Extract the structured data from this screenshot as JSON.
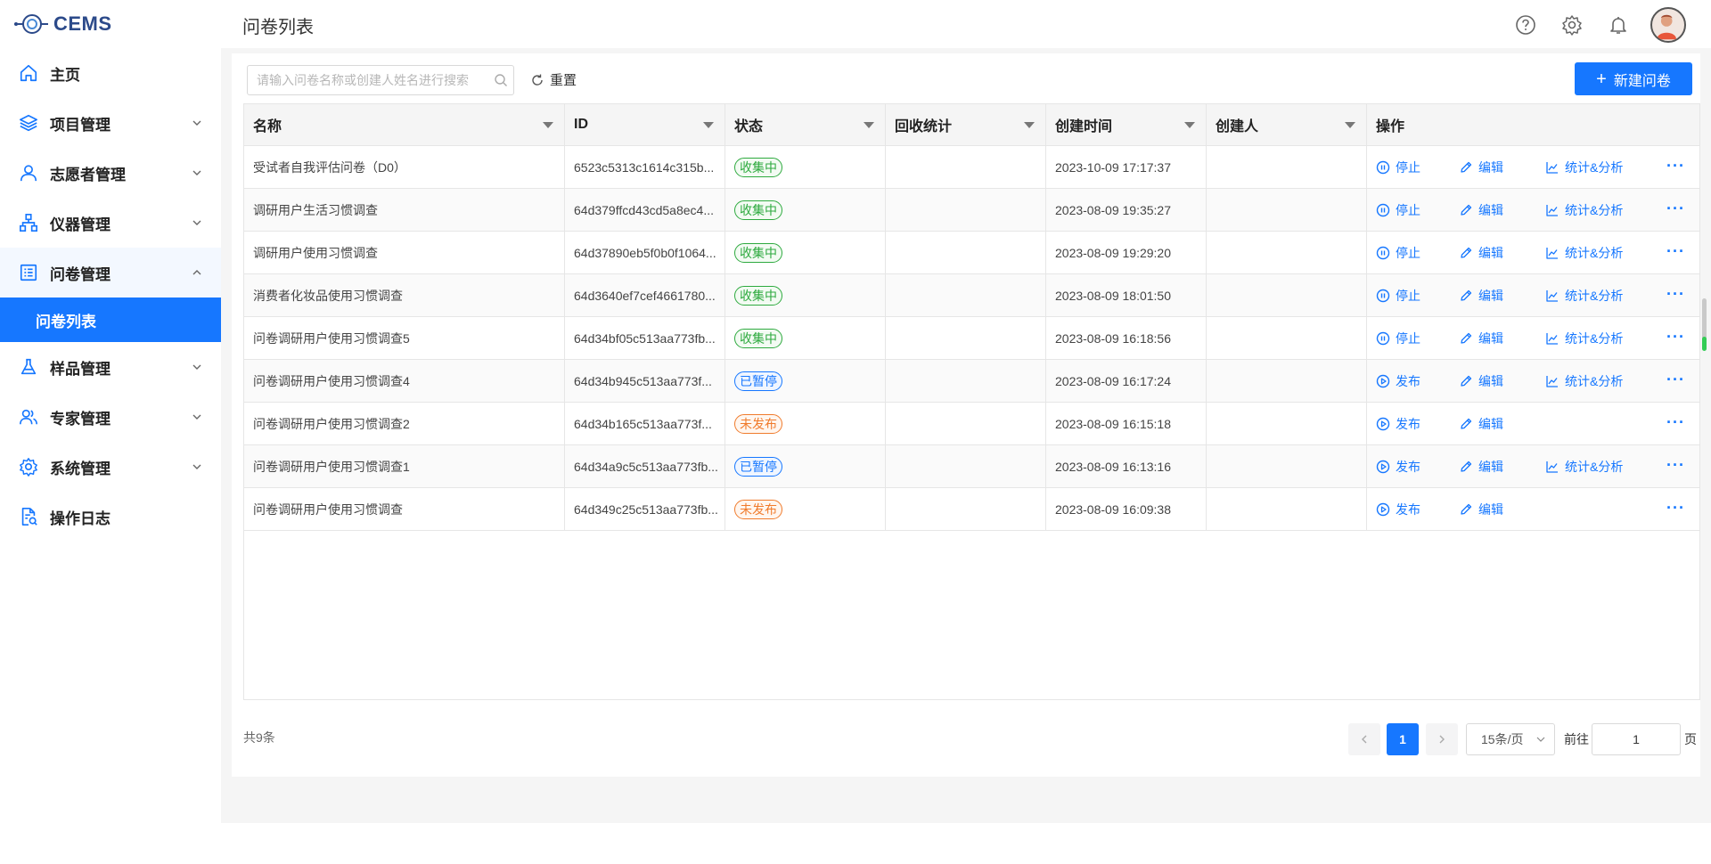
{
  "app": {
    "logo_text": "CEMS"
  },
  "header": {
    "title": "问卷列表"
  },
  "sidebar": {
    "items": [
      {
        "label": "主页",
        "icon": "home-icon"
      },
      {
        "label": "项目管理",
        "icon": "layers-icon"
      },
      {
        "label": "志愿者管理",
        "icon": "user-icon"
      },
      {
        "label": "仪器管理",
        "icon": "network-icon"
      },
      {
        "label": "问卷管理",
        "icon": "form-icon"
      },
      {
        "label": "样品管理",
        "icon": "flask-icon"
      },
      {
        "label": "专家管理",
        "icon": "users-icon"
      },
      {
        "label": "系统管理",
        "icon": "gear-icon"
      },
      {
        "label": "操作日志",
        "icon": "log-icon"
      }
    ],
    "submenu": {
      "label": "问卷列表"
    }
  },
  "toolbar": {
    "search_placeholder": "请输入问卷名称或创建人姓名进行搜索",
    "reset_label": "重置",
    "new_button_label": "新建问卷"
  },
  "table": {
    "columns": [
      "名称",
      "ID",
      "状态",
      "回收统计",
      "创建时间",
      "创建人",
      "操作"
    ],
    "rows": [
      {
        "name": "受试者自我评估问卷（D0）",
        "id": "6523c5313c1614c315b...",
        "status": "收集中",
        "status_color": "#2eaa3f",
        "created": "2023-10-09 17:17:37",
        "action1": "停止",
        "edit": "编辑",
        "stats": "统计&分析"
      },
      {
        "name": "调研用户生活习惯调查",
        "id": "64d379ffcd43cd5a8ec4...",
        "status": "收集中",
        "status_color": "#2eaa3f",
        "created": "2023-08-09 19:35:27",
        "action1": "停止",
        "edit": "编辑",
        "stats": "统计&分析"
      },
      {
        "name": "调研用户使用习惯调查",
        "id": "64d37890eb5f0b0f1064...",
        "status": "收集中",
        "status_color": "#2eaa3f",
        "created": "2023-08-09 19:29:20",
        "action1": "停止",
        "edit": "编辑",
        "stats": "统计&分析"
      },
      {
        "name": "消费者化妆品使用习惯调查",
        "id": "64d3640ef7cef4661780...",
        "status": "收集中",
        "status_color": "#2eaa3f",
        "created": "2023-08-09 18:01:50",
        "action1": "停止",
        "edit": "编辑",
        "stats": "统计&分析"
      },
      {
        "name": "问卷调研用户使用习惯调查5",
        "id": "64d34bf05c513aa773fb...",
        "status": "收集中",
        "status_color": "#2eaa3f",
        "created": "2023-08-09 16:18:56",
        "action1": "停止",
        "edit": "编辑",
        "stats": "统计&分析"
      },
      {
        "name": "问卷调研用户使用习惯调查4",
        "id": "64d34b945c513aa773f...",
        "status": "已暂停",
        "status_color": "#1677ff",
        "created": "2023-08-09 16:17:24",
        "action1": "发布",
        "edit": "编辑",
        "stats": "统计&分析"
      },
      {
        "name": "问卷调研用户使用习惯调查2",
        "id": "64d34b165c513aa773f...",
        "status": "未发布",
        "status_color": "#f07b2c",
        "created": "2023-08-09 16:15:18",
        "action1": "发布",
        "edit": "编辑",
        "stats": ""
      },
      {
        "name": "问卷调研用户使用习惯调查1",
        "id": "64d34a9c5c513aa773fb...",
        "status": "已暂停",
        "status_color": "#1677ff",
        "created": "2023-08-09 16:13:16",
        "action1": "发布",
        "edit": "编辑",
        "stats": "统计&分析"
      },
      {
        "name": "问卷调研用户使用习惯调查",
        "id": "64d349c25c513aa773fb...",
        "status": "未发布",
        "status_color": "#f07b2c",
        "created": "2023-08-09 16:09:38",
        "action1": "发布",
        "edit": "编辑",
        "stats": ""
      }
    ]
  },
  "pagination": {
    "total_text": "共9条",
    "current_page": "1",
    "page_size": "15条/页",
    "goto_label": "前往",
    "goto_value": "1",
    "page_suffix": "页"
  },
  "colors": {
    "accent": "#1677ff",
    "collecting": "#2eaa3f",
    "paused": "#1677ff",
    "unpublished": "#f07b2c"
  }
}
